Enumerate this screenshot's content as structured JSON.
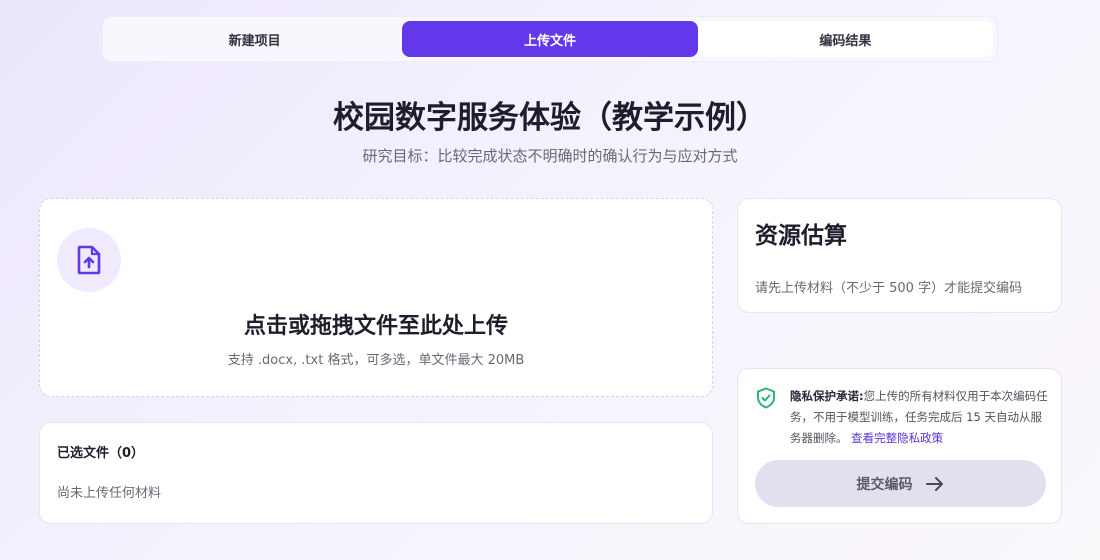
{
  "stepper": {
    "steps": [
      {
        "label": "新建项目"
      },
      {
        "label": "上传文件"
      },
      {
        "label": "编码结果"
      }
    ]
  },
  "header": {
    "title": "校园数字服务体验（教学示例）",
    "subtitle": "研究目标：比较完成状态不明确时的确认行为与应对方式"
  },
  "upload": {
    "title": "点击或拖拽文件至此处上传",
    "hint": "支持 .docx, .txt 格式，可多选，单文件最大 20MB",
    "icon": "file-upload-icon"
  },
  "selected_files": {
    "title": "已选文件（0）",
    "empty": "尚未上传任何材料"
  },
  "estimate": {
    "title": "资源估算",
    "desc": "请先上传材料（不少于 500 字）才能提交编码"
  },
  "privacy": {
    "label": "隐私保护承诺:",
    "text": "您上传的所有材料仅用于本次编码任务，不用于模型训练，任务完成后 15 天自动从服务器删除。",
    "link": "查看完整隐私政策",
    "icon": "shield-check-icon"
  },
  "submit": {
    "label": "提交编码",
    "icon": "arrow-right-icon"
  },
  "colors": {
    "accent": "#6338ea",
    "shield": "#2bb673"
  }
}
